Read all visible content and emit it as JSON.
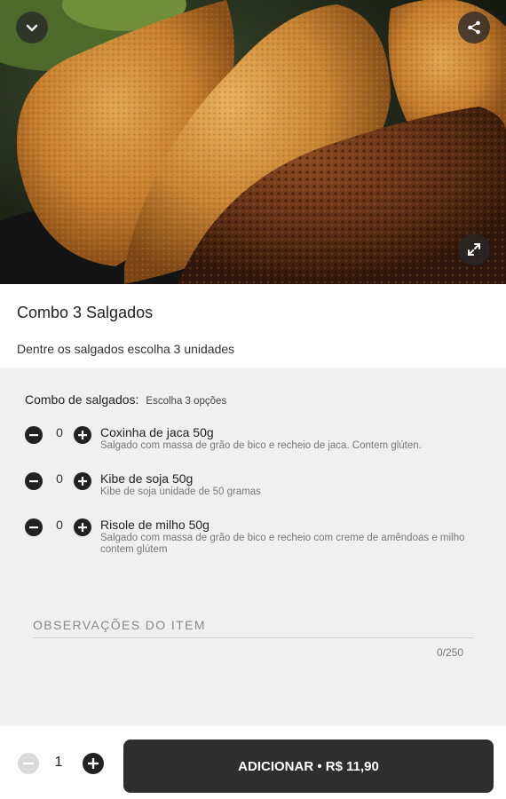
{
  "product": {
    "title": "Combo 3 Salgados",
    "description": "Dentre os salgados escolha 3 unidades",
    "image_alt": "photo of fried Brazilian snacks"
  },
  "hero_actions": {
    "back_icon": "chevron-down-icon",
    "share_icon": "share-icon",
    "expand_icon": "expand-icon"
  },
  "options_group": {
    "title": "Combo de salgados:",
    "hint": "Escolha 3 opções",
    "items": [
      {
        "name": "Coxinha de jaca 50g",
        "description": "Salgado com massa de grão de bico e recheio de jaca. Contem glúten.",
        "quantity": "0"
      },
      {
        "name": "Kibe de soja 50g",
        "description": "Kibe de soja unidade de 50 gramas",
        "quantity": "0"
      },
      {
        "name": "Risole de milho 50g",
        "description": "Salgado com massa de grão de bico e recheio com creme de amêndoas e milho contem glútem",
        "quantity": "0"
      }
    ]
  },
  "observations": {
    "label": "OBSERVAÇÕES DO ITEM",
    "counter": "0/250"
  },
  "footer": {
    "quantity": "1",
    "add_label": "ADICIONAR • R$ 11,90"
  },
  "colors": {
    "dark_button": "#2e2e2e",
    "panel_bg": "#f0f0f0",
    "icon_dark": "#222222",
    "icon_disabled": "#d9d9d9"
  }
}
